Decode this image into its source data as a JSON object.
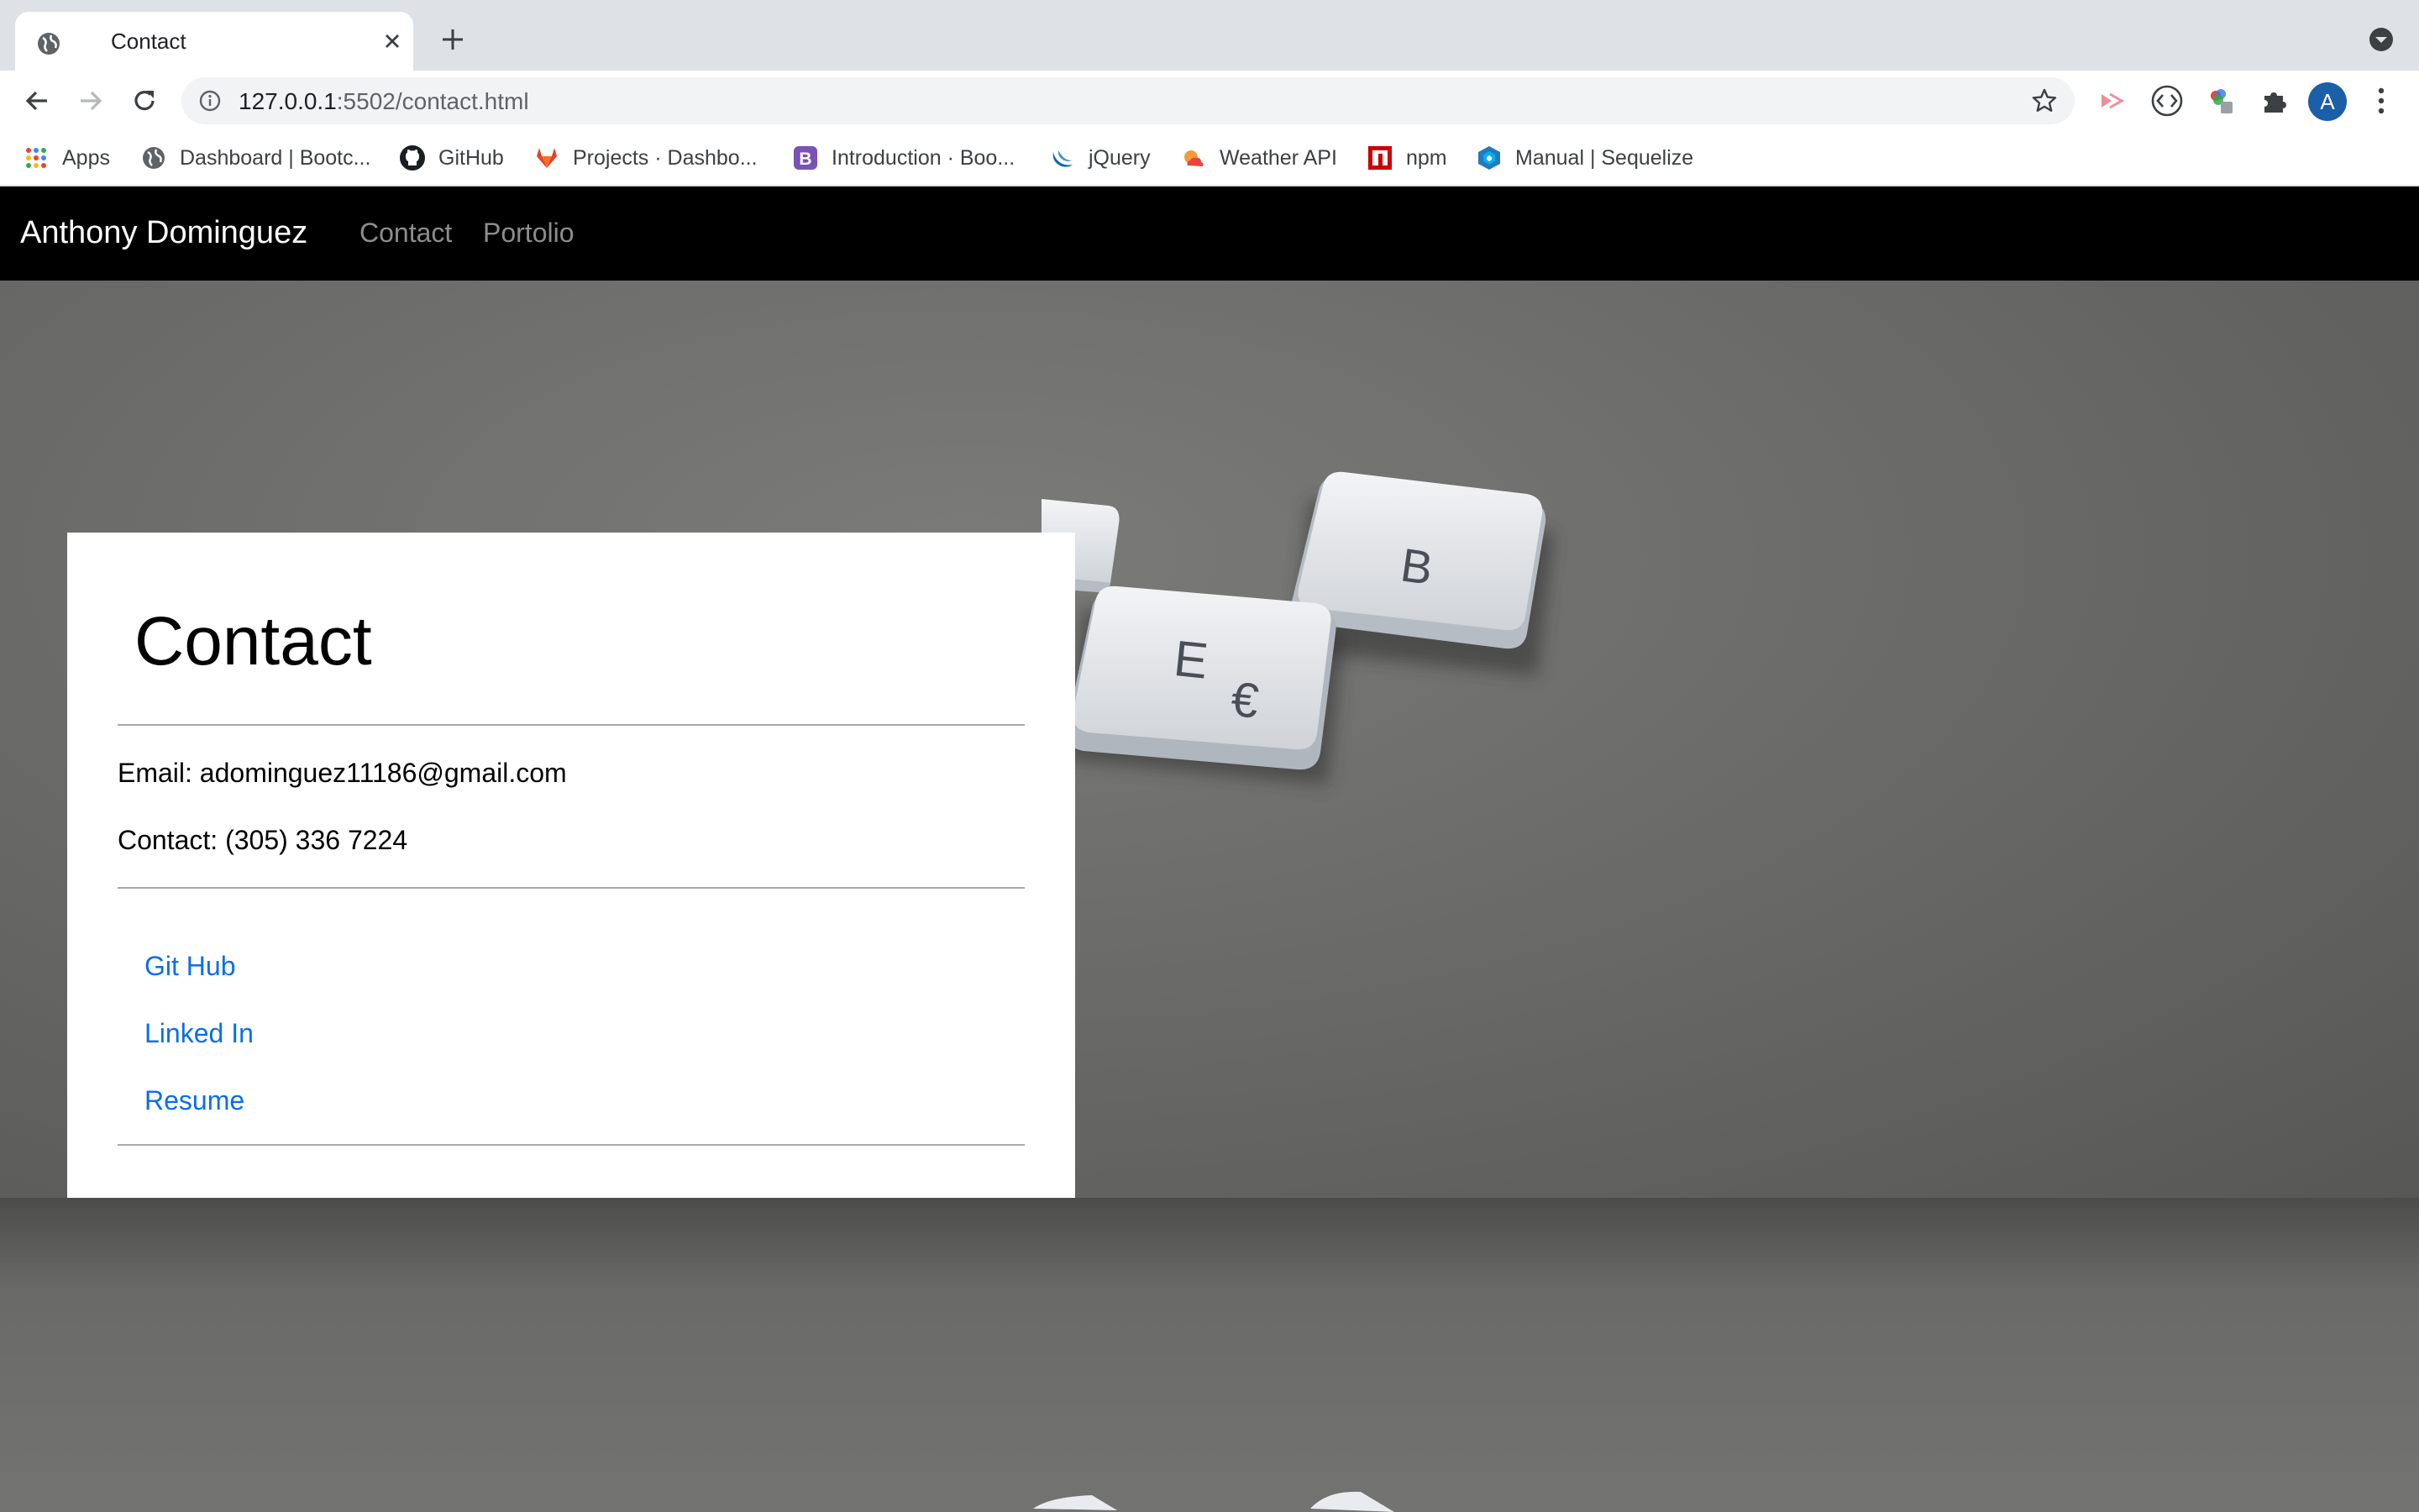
{
  "browser": {
    "tab_title": "Contact",
    "url_host": "127.0.0.1",
    "url_rest": ":5502/contact.html",
    "avatar_letter": "A",
    "bookmarks": [
      {
        "label": "Apps",
        "icon": "apps-grid-icon"
      },
      {
        "label": "Dashboard | Bootc...",
        "icon": "globe-icon"
      },
      {
        "label": "GitHub",
        "icon": "github-icon"
      },
      {
        "label": "Projects · Dashbo...",
        "icon": "gitlab-icon"
      },
      {
        "label": "Introduction · Boo...",
        "icon": "bootstrap-icon"
      },
      {
        "label": "jQuery",
        "icon": "jquery-icon"
      },
      {
        "label": "Weather API",
        "icon": "weather-icon"
      },
      {
        "label": "npm",
        "icon": "npm-icon"
      },
      {
        "label": "Manual | Sequelize",
        "icon": "sequelize-icon"
      }
    ]
  },
  "navbar": {
    "brand": "Anthony Dominguez",
    "links": [
      "Contact",
      "Portolio"
    ]
  },
  "contact_card": {
    "title": "Contact",
    "email": "Email: adominguez11186@gmail.com",
    "phone": "Contact: (305) 336 7224",
    "links": [
      "Git Hub",
      "Linked In",
      "Resume"
    ]
  },
  "hero_keys": {
    "b_key": "B",
    "e_key": "E",
    "euro_symbol": "€"
  }
}
